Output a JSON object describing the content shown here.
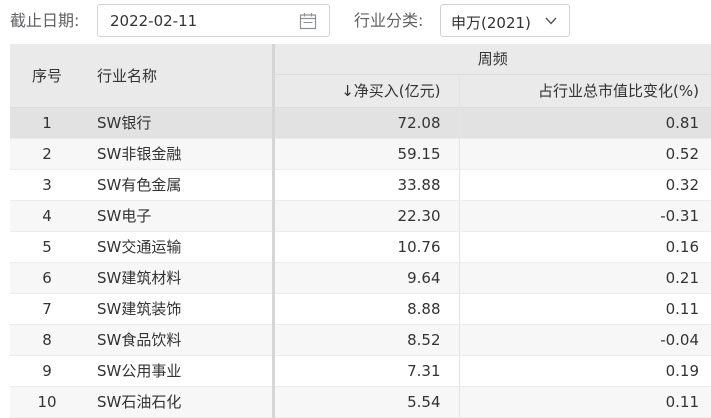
{
  "filters": {
    "date_label": "截止日期:",
    "date_value": "2022-02-11",
    "industry_label": "行业分类:",
    "industry_value": "申万(2021)"
  },
  "table": {
    "headers": {
      "index": "序号",
      "name": "行业名称",
      "group": "周频",
      "net_buy": "↓净买入(亿元)",
      "mv_change": "占行业总市值比变化(%)"
    },
    "rows": [
      {
        "index": "1",
        "name": "SW银行",
        "net_buy": "72.08",
        "mv_change": "0.81"
      },
      {
        "index": "2",
        "name": "SW非银金融",
        "net_buy": "59.15",
        "mv_change": "0.52"
      },
      {
        "index": "3",
        "name": "SW有色金属",
        "net_buy": "33.88",
        "mv_change": "0.32"
      },
      {
        "index": "4",
        "name": "SW电子",
        "net_buy": "22.30",
        "mv_change": "-0.31"
      },
      {
        "index": "5",
        "name": "SW交通运输",
        "net_buy": "10.76",
        "mv_change": "0.16"
      },
      {
        "index": "6",
        "name": "SW建筑材料",
        "net_buy": "9.64",
        "mv_change": "0.21"
      },
      {
        "index": "7",
        "name": "SW建筑装饰",
        "net_buy": "8.88",
        "mv_change": "0.11"
      },
      {
        "index": "8",
        "name": "SW食品饮料",
        "net_buy": "8.52",
        "mv_change": "-0.04"
      },
      {
        "index": "9",
        "name": "SW公用事业",
        "net_buy": "7.31",
        "mv_change": "0.19"
      },
      {
        "index": "10",
        "name": "SW石油石化",
        "net_buy": "5.54",
        "mv_change": "0.11"
      }
    ]
  },
  "icons": {
    "date_picker": "calendar-icon",
    "industry_select": "chevron-down-icon"
  }
}
